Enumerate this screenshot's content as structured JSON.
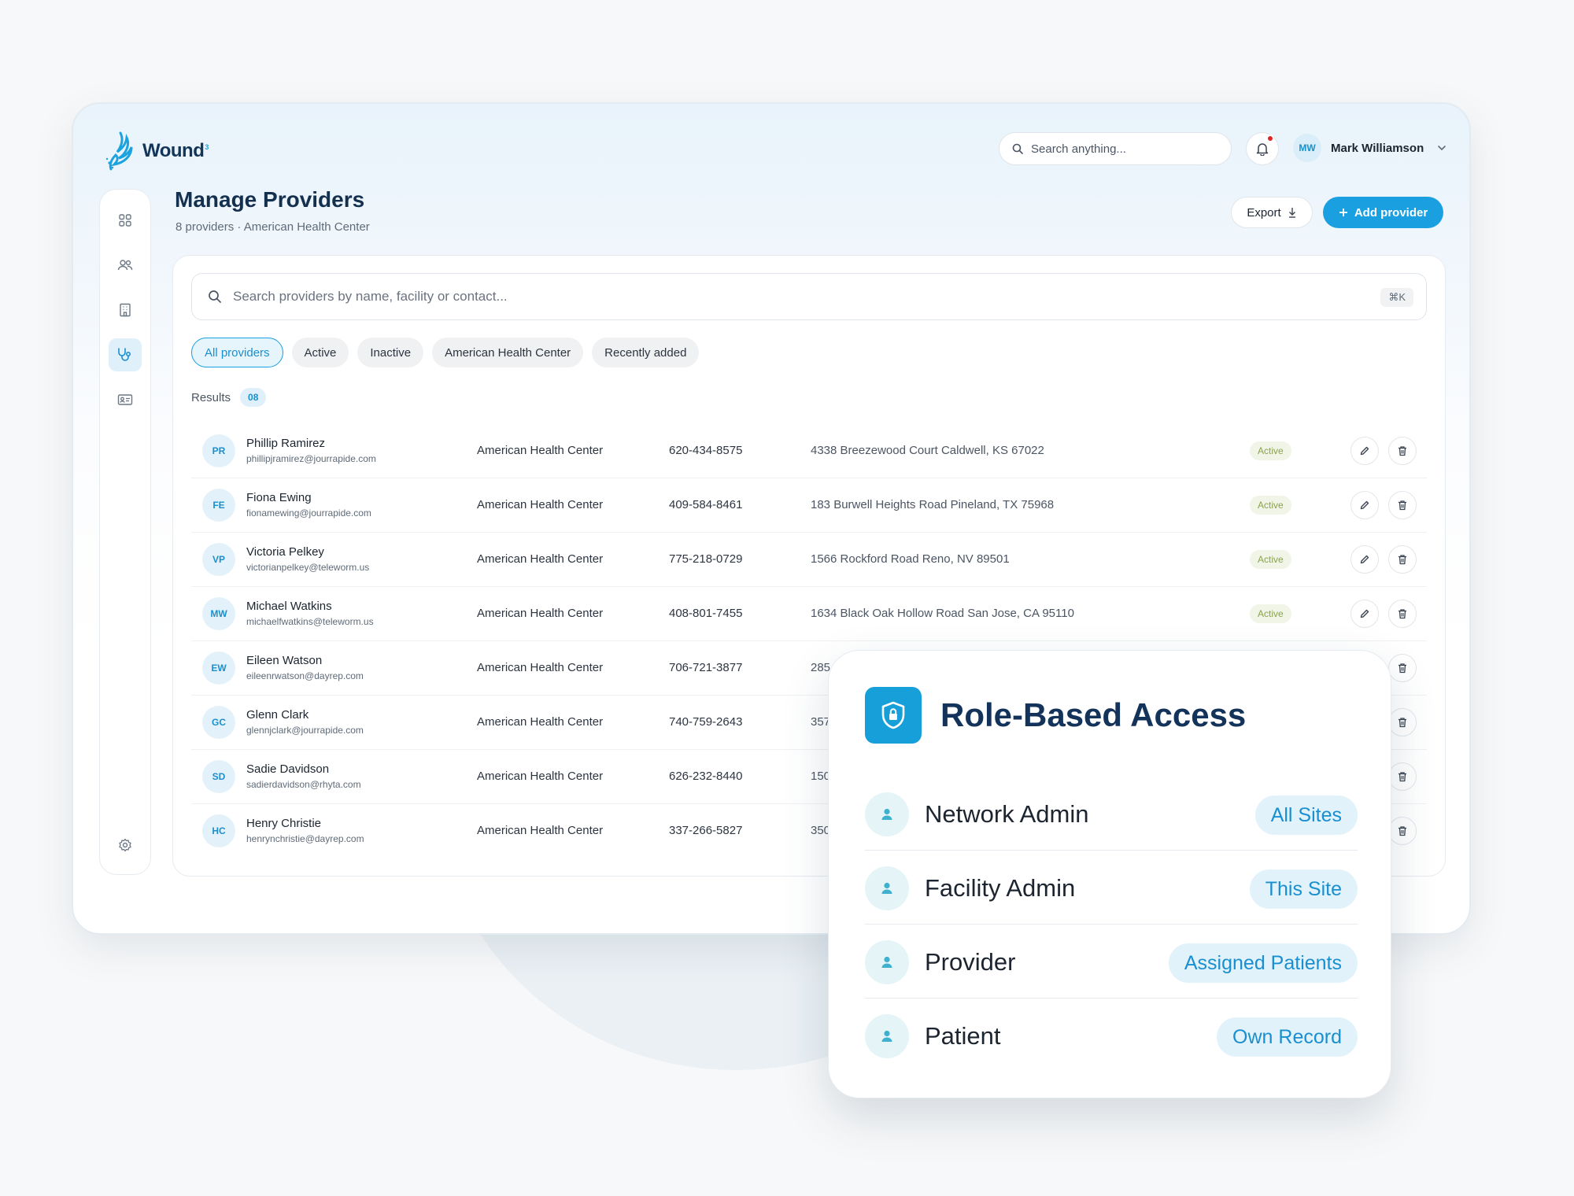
{
  "app": {
    "logo_text": "Wound",
    "logo_sup": "3"
  },
  "header": {
    "search_placeholder": "Search anything...",
    "user_initials": "MW",
    "user_name": "Mark Williamson"
  },
  "page": {
    "title": "Manage Providers",
    "subtitle": "8 providers · American Health Center",
    "export_label": "Export",
    "add_label": "Add provider"
  },
  "search": {
    "placeholder": "Search providers by name, facility or contact...",
    "shortcut": "⌘K"
  },
  "filters": [
    "All providers",
    "Active",
    "Inactive",
    "American Health Center",
    "Recently added"
  ],
  "results": {
    "label": "Results",
    "count": "08"
  },
  "providers": [
    {
      "initials": "PR",
      "name": "Phillip Ramirez",
      "email": "phillipjramirez@jourrapide.com",
      "facility": "American Health Center",
      "phone": "620-434-8575",
      "address": "4338 Breezewood Court Caldwell, KS 67022",
      "status": "Active"
    },
    {
      "initials": "FE",
      "name": "Fiona Ewing",
      "email": "fionamewing@jourrapide.com",
      "facility": "American Health Center",
      "phone": "409-584-8461",
      "address": "183 Burwell Heights Road Pineland, TX 75968",
      "status": "Active"
    },
    {
      "initials": "VP",
      "name": "Victoria Pelkey",
      "email": "victorianpelkey@teleworm.us",
      "facility": "American Health Center",
      "phone": "775-218-0729",
      "address": "1566 Rockford Road Reno, NV 89501",
      "status": "Active"
    },
    {
      "initials": "MW",
      "name": "Michael Watkins",
      "email": "michaelfwatkins@teleworm.us",
      "facility": "American Health Center",
      "phone": "408-801-7455",
      "address": "1634 Black Oak Hollow Road San Jose, CA 95110",
      "status": "Active"
    },
    {
      "initials": "EW",
      "name": "Eileen Watson",
      "email": "eileenrwatson@dayrep.com",
      "facility": "American Health Center",
      "phone": "706-721-3877",
      "address": "285",
      "status": ""
    },
    {
      "initials": "GC",
      "name": "Glenn Clark",
      "email": "glennjclark@jourrapide.com",
      "facility": "American Health Center",
      "phone": "740-759-2643",
      "address": "357",
      "status": ""
    },
    {
      "initials": "SD",
      "name": "Sadie Davidson",
      "email": "sadierdavidson@rhyta.com",
      "facility": "American Health Center",
      "phone": "626-232-8440",
      "address": "150",
      "status": ""
    },
    {
      "initials": "HC",
      "name": "Henry Christie",
      "email": "henrynchristie@dayrep.com",
      "facility": "American Health Center",
      "phone": "337-266-5827",
      "address": "350",
      "status": ""
    }
  ],
  "role_card": {
    "title": "Role-Based Access",
    "roles": [
      {
        "label": "Network Admin",
        "scope": "All Sites"
      },
      {
        "label": "Facility Admin",
        "scope": "This Site"
      },
      {
        "label": "Provider",
        "scope": "Assigned Patients"
      },
      {
        "label": "Patient",
        "scope": "Own Record"
      }
    ]
  },
  "colors": {
    "accent": "#1a9fe0",
    "brand_dark": "#13335a",
    "status_active": "#8aa34a",
    "alert": "#e02424"
  },
  "icons": [
    "logo-icon",
    "search-icon",
    "bell-icon",
    "chevron-down-icon",
    "grid-icon",
    "users-icon",
    "building-icon",
    "stethoscope-icon",
    "id-card-icon",
    "gear-icon",
    "download-icon",
    "plus-icon",
    "edit-icon",
    "trash-icon",
    "shield-lock-icon",
    "person-icon"
  ]
}
